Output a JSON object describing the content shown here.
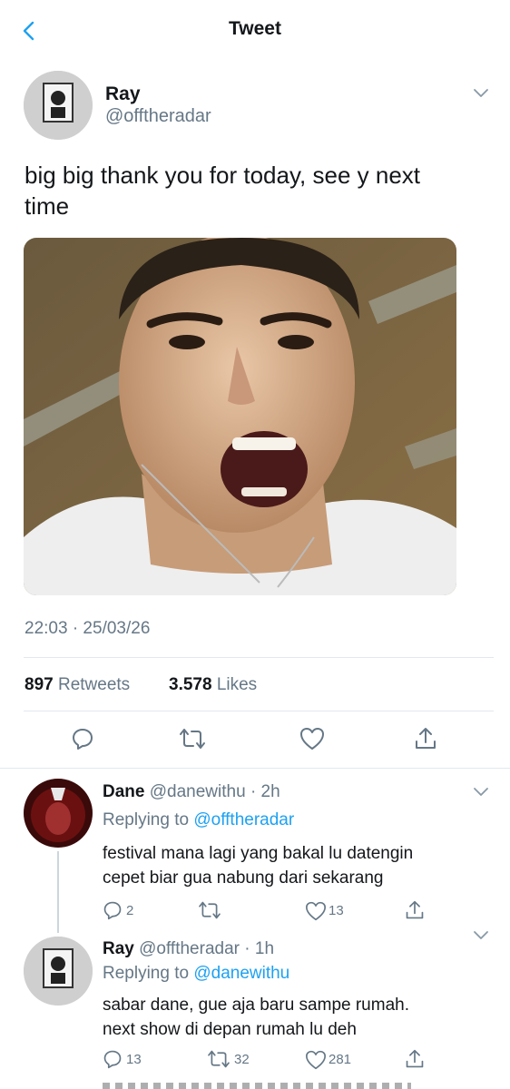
{
  "header": {
    "title": "Tweet"
  },
  "tweet": {
    "author_name": "Ray",
    "author_handle": "@offtheradar",
    "text": "big big thank you for today, see y next time",
    "timestamp": "22:03 · 25/03/26",
    "retweets_count": "897",
    "retweets_label": "Retweets",
    "likes_count": "3.578",
    "likes_label": "Likes"
  },
  "replies": [
    {
      "name": "Dane",
      "handle": "@danewithu",
      "time": "· 2h",
      "replying_prefix": "Replying to",
      "replying_to": "@offtheradar",
      "text_line1": "festival mana lagi yang bakal lu datengin",
      "text_line2": "cepet biar gua nabung dari sekarang",
      "reply_count": "2",
      "retweet_count": "",
      "like_count": "13"
    },
    {
      "name": "Ray",
      "handle": "@offtheradar",
      "time": "· 1h",
      "replying_prefix": "Replying to",
      "replying_to": "@danewithu",
      "text_line1": "sabar dane, gue aja baru sampe rumah.",
      "text_line2": "next show di depan rumah lu deh",
      "reply_count": "13",
      "retweet_count": "32",
      "like_count": "281"
    }
  ],
  "colors": {
    "accent": "#1da1f2",
    "secondary_text": "#657786",
    "divider": "#e1e8ed"
  }
}
